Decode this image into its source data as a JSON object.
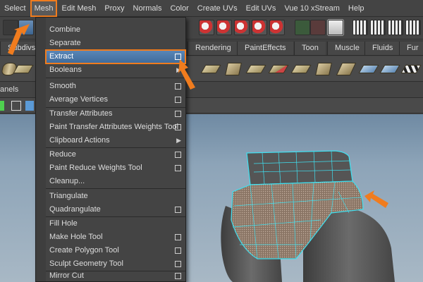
{
  "menubar": {
    "items": [
      "Select",
      "Mesh",
      "Edit Mesh",
      "Proxy",
      "Normals",
      "Color",
      "Create UVs",
      "Edit UVs",
      "Vue 10 xStream",
      "Help"
    ],
    "active": "Mesh"
  },
  "shelf_tabs": [
    "Subdivs",
    "Rendering",
    "PaintEffects",
    "Toon",
    "Muscle",
    "Fluids",
    "Fur"
  ],
  "panels_label": "anels",
  "mesh_menu": {
    "items": [
      {
        "label": "Combine",
        "option": false,
        "submenu": false
      },
      {
        "label": "Separate",
        "option": false,
        "submenu": false
      },
      {
        "label": "Extract",
        "option": true,
        "submenu": false,
        "highlighted": true
      },
      {
        "label": "Booleans",
        "option": false,
        "submenu": true
      },
      {
        "label": "Smooth",
        "option": true,
        "submenu": false
      },
      {
        "label": "Average Vertices",
        "option": true,
        "submenu": false
      },
      {
        "label": "Transfer Attributes",
        "option": true,
        "submenu": false
      },
      {
        "label": "Paint Transfer Attributes Weights Tool",
        "option": true,
        "submenu": false
      },
      {
        "label": "Clipboard Actions",
        "option": false,
        "submenu": true
      },
      {
        "label": "Reduce",
        "option": true,
        "submenu": false
      },
      {
        "label": "Paint Reduce Weights Tool",
        "option": true,
        "submenu": false
      },
      {
        "label": "Cleanup...",
        "option": false,
        "submenu": false
      },
      {
        "label": "Triangulate",
        "option": false,
        "submenu": false
      },
      {
        "label": "Quadrangulate",
        "option": true,
        "submenu": false
      },
      {
        "label": "Fill Hole",
        "option": false,
        "submenu": false
      },
      {
        "label": "Make Hole Tool",
        "option": true,
        "submenu": false
      },
      {
        "label": "Create Polygon Tool",
        "option": true,
        "submenu": false
      },
      {
        "label": "Sculpt Geometry Tool",
        "option": true,
        "submenu": false
      },
      {
        "label": "Mirror Cut",
        "option": true,
        "submenu": false
      }
    ]
  },
  "colors": {
    "accent_orange": "#f07c1e",
    "highlight_blue": "#4a78aa",
    "mesh_cyan": "#3fe0f0",
    "viewport_bg": "#8da4b8"
  }
}
